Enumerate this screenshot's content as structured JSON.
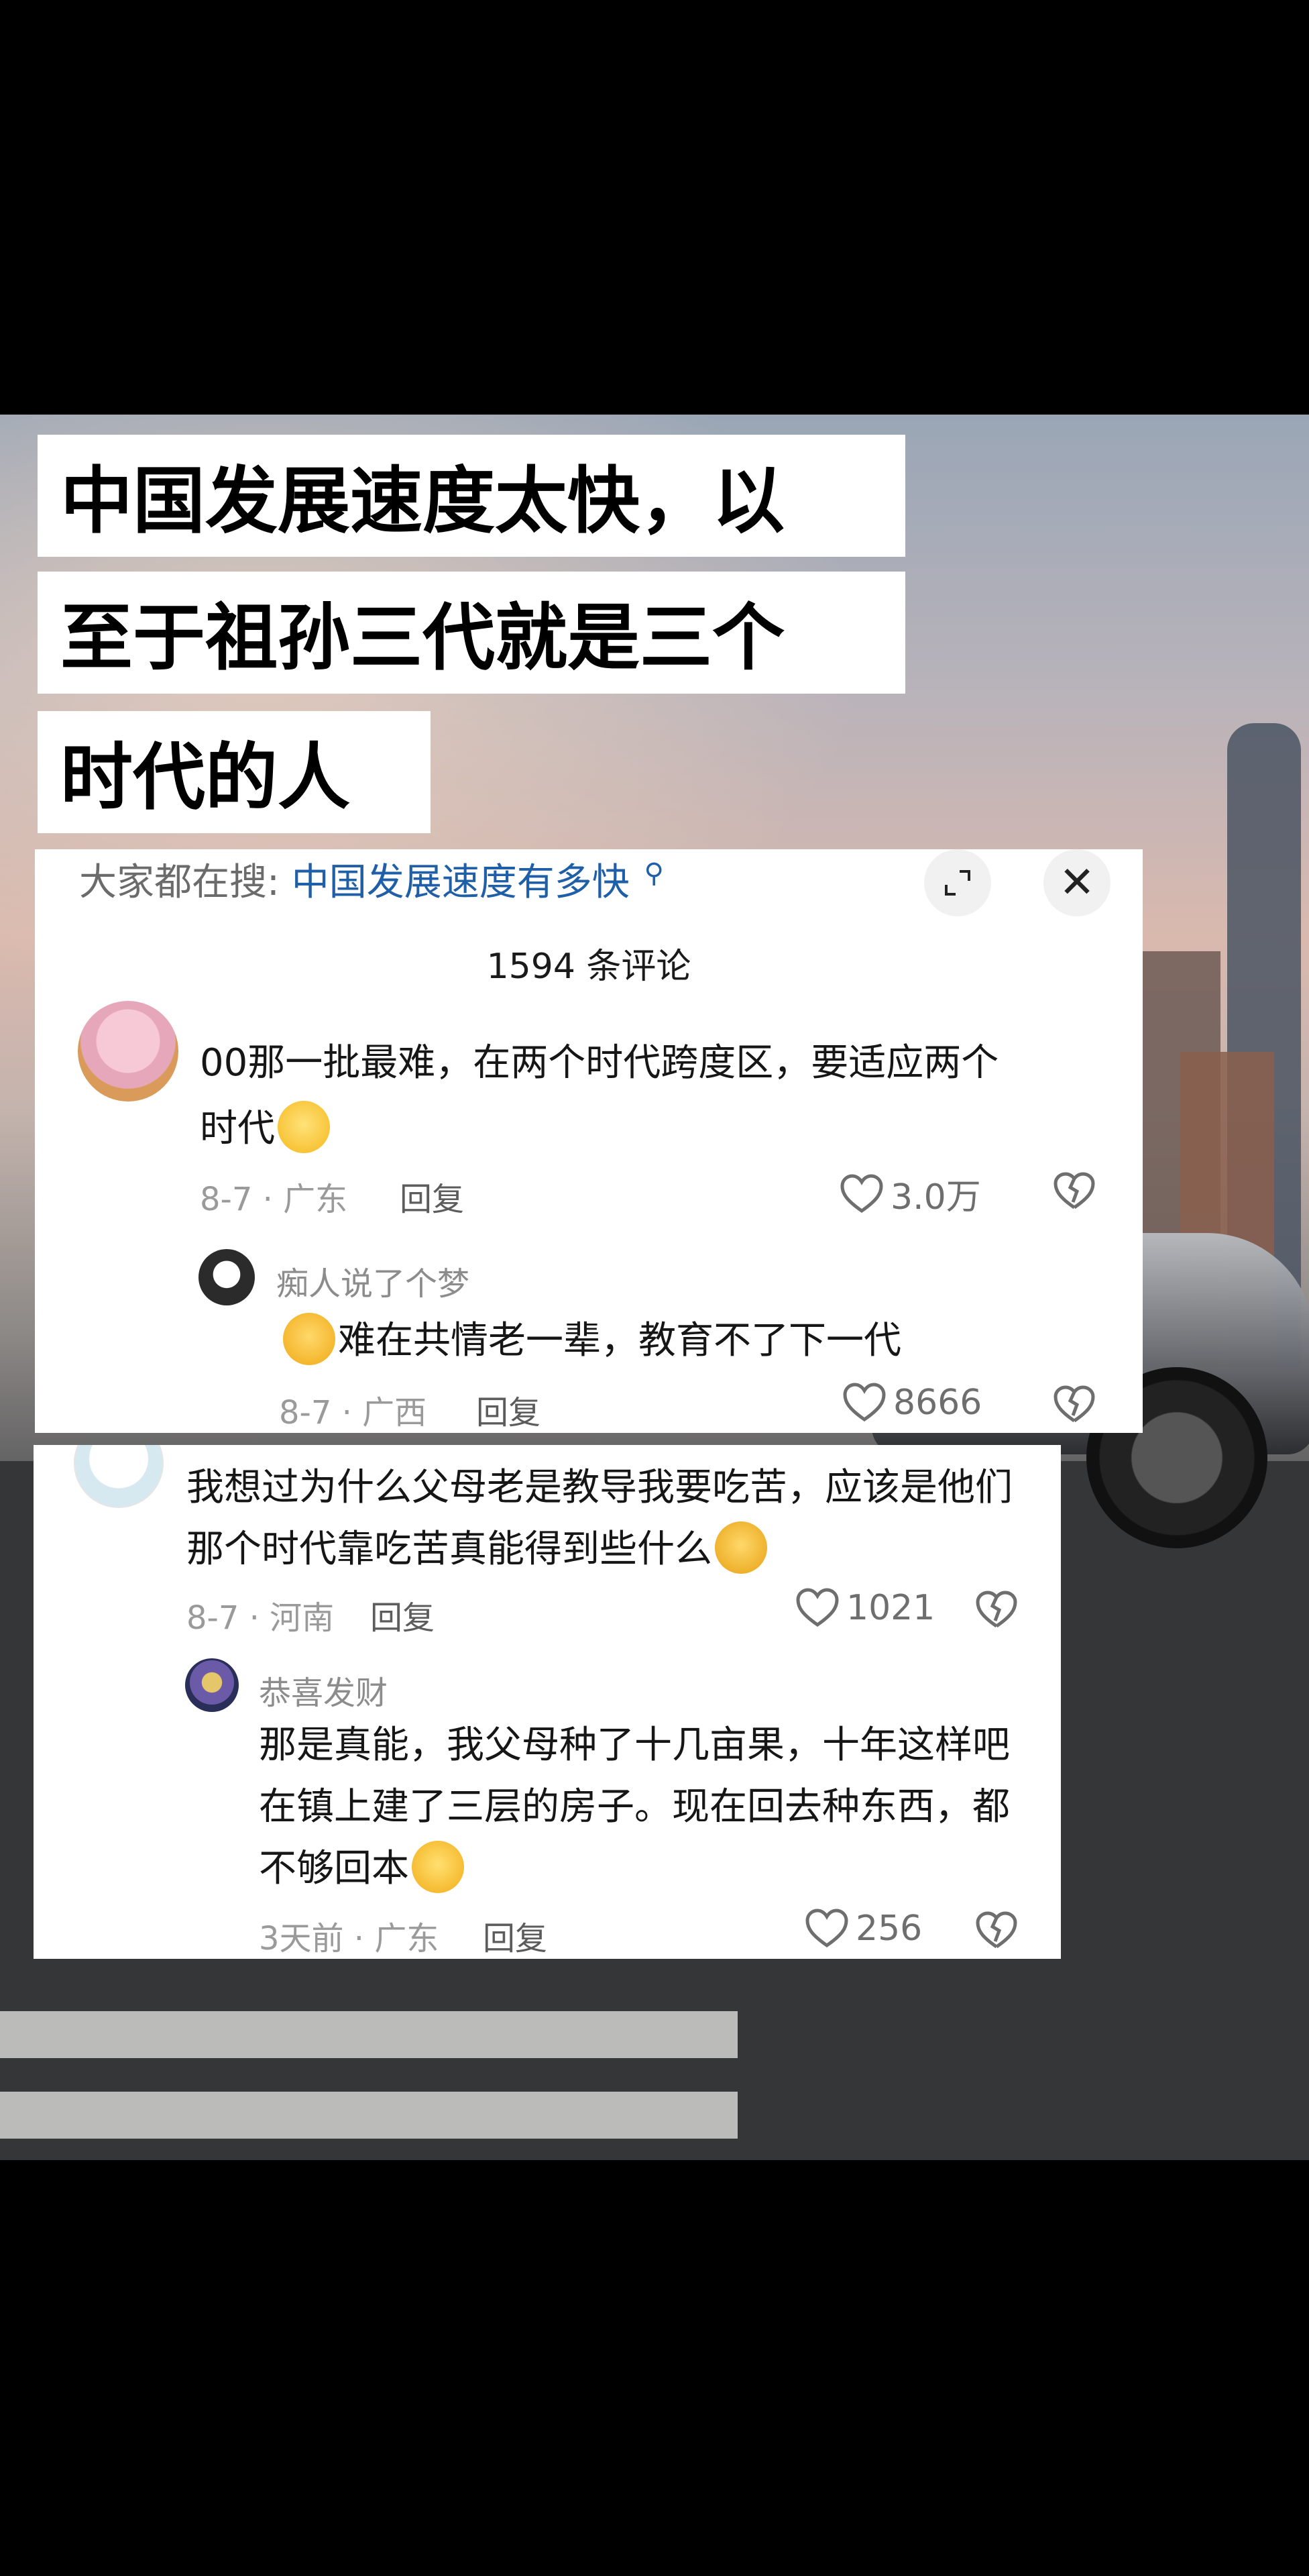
{
  "headline": {
    "line1": "中国发展速度太快，以",
    "line2": "至于祖孙三代就是三个",
    "line3": "时代的人"
  },
  "panel1": {
    "search_prefix": "大家都在搜:",
    "search_term": "中国发展速度有多快",
    "comment_count": "1594 条评论",
    "comment": {
      "text_line1": "00那一批最难，在两个时代跨度区，要适应两个",
      "text_line2": "时代",
      "emoji": "dizzy-face-emoji",
      "date_location": "8-7 · 广东",
      "reply_label": "回复",
      "likes": "3.0万"
    },
    "reply": {
      "username": "痴人说了个梦",
      "emoji": "crying-face-emoji",
      "text": "难在共情老一辈，教育不了下一代",
      "date_location": "8-7 · 广西",
      "reply_label": "回复",
      "likes": "8666"
    }
  },
  "panel2": {
    "comment": {
      "text_line1": "我想过为什么父母老是教导我要吃苦，应该是他们",
      "text_line2": "那个时代靠吃苦真能得到些什么",
      "emoji": "sad-face-emoji",
      "date_location": "8-7 · 河南",
      "reply_label": "回复",
      "likes": "1021"
    },
    "reply": {
      "username": "恭喜发财",
      "text_line1": "那是真能，我父母种了十几亩果，十年这样吧",
      "text_line2": "在镇上建了三层的房子。现在回去种东西，都",
      "text_line3": "不够回本",
      "emoji": "laughing-crying-emoji",
      "date_location": "3天前 · 广东",
      "reply_label": "回复",
      "likes": "256"
    }
  }
}
